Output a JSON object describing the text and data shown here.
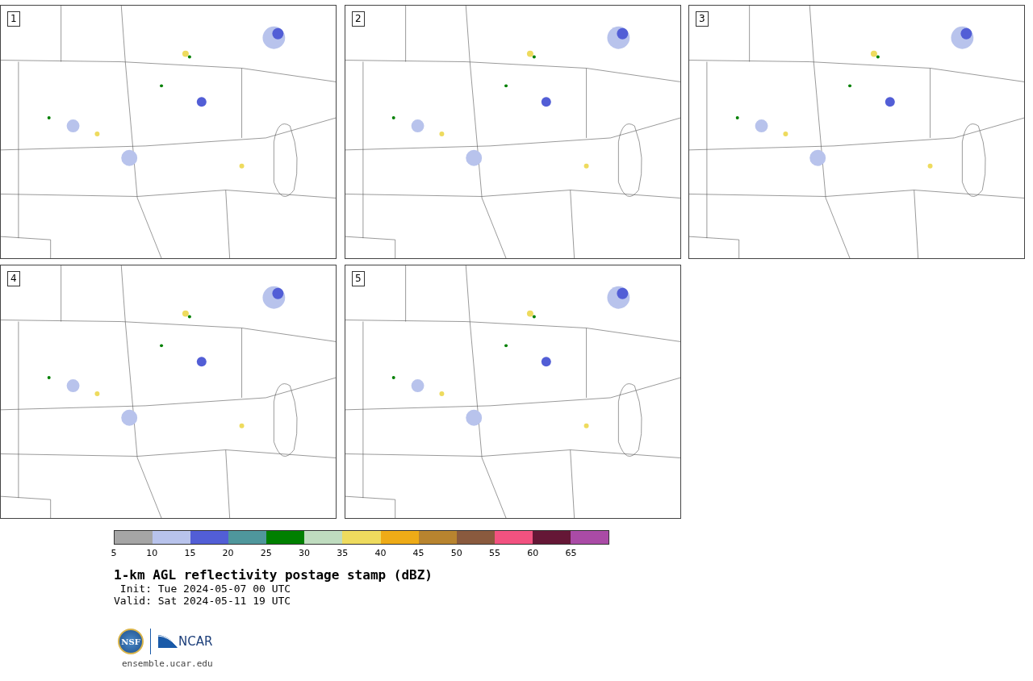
{
  "panels": [
    {
      "label": "1"
    },
    {
      "label": "2"
    },
    {
      "label": "3"
    },
    {
      "label": "4"
    },
    {
      "label": "5"
    }
  ],
  "colorbar": {
    "bins": [
      {
        "color": "#a5a5a5"
      },
      {
        "color": "#b8c3ec"
      },
      {
        "color": "#525ed6"
      },
      {
        "color": "#4f979c"
      },
      {
        "color": "#008000"
      },
      {
        "color": "#bfdcbf"
      },
      {
        "color": "#eedb5e"
      },
      {
        "color": "#eeab17"
      },
      {
        "color": "#b8842f"
      },
      {
        "color": "#8a5a3e"
      },
      {
        "color": "#f25280"
      },
      {
        "color": "#651736"
      },
      {
        "color": "#aa4ba6"
      }
    ],
    "ticks": [
      "5",
      "10",
      "15",
      "20",
      "25",
      "30",
      "35",
      "40",
      "45",
      "50",
      "55",
      "60",
      "65"
    ]
  },
  "title": "1-km AGL reflectivity postage stamp (dBZ)",
  "init": " Init: Tue 2024-05-07 00 UTC",
  "valid": "Valid: Sat 2024-05-11 19 UTC",
  "logos": [
    {
      "kind": "nsf",
      "text": "NSF"
    },
    {
      "kind": "ncar",
      "text": "NCAR"
    }
  ],
  "site": "ensemble.ucar.edu"
}
